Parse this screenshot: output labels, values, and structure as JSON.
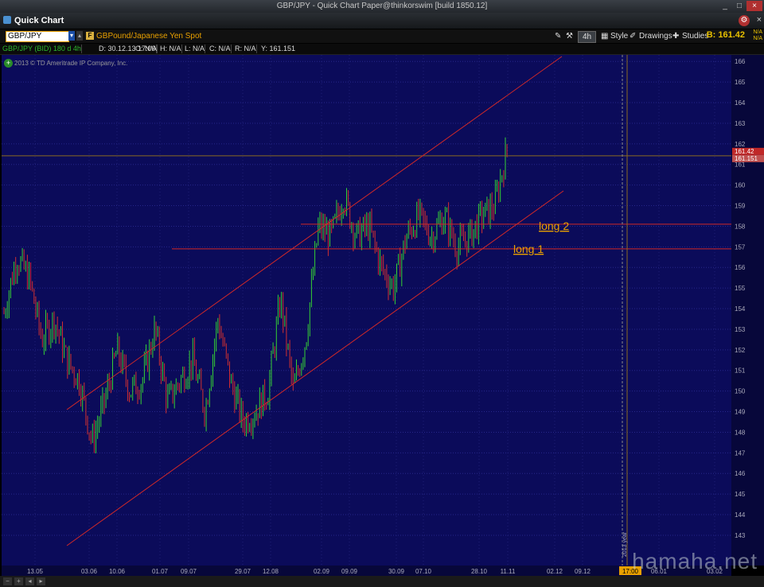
{
  "window": {
    "title": "GBP/JPY - Quick Chart Paper@thinkorswim [build 1850.12]",
    "minimize": "_",
    "maximize": "□",
    "close": "×"
  },
  "app": {
    "title": "Quick Chart",
    "close": "×"
  },
  "toolbar": {
    "symbol": "GBP/JPY",
    "symbol_name": "GBPound/Japanese Yen Spot",
    "timeframe": "4h",
    "style_label": "Style",
    "drawings_label": "Drawings",
    "studies_label": "Studies",
    "bid": "B: 161.42",
    "na1": "N/A",
    "na2": "N/A"
  },
  "infobar": {
    "symbol": "GBP/JPY (BID) 180 d 4h",
    "date": "D: 30.12.13 17:00",
    "open": "O: N/A",
    "high": "H: N/A",
    "low": "L: N/A",
    "close": "C: N/A",
    "range": "R: N/A",
    "y": "Y: 161.151"
  },
  "copyright": "2013 © TD Ameritrade IP Company, Inc.",
  "watermark": "hamaha.net",
  "colors": {
    "plot_bg": "#0b0b5a",
    "up": "#35d035",
    "down": "#d03030",
    "trendline": "#d02828",
    "accent": "#e8a000"
  },
  "chart_data": {
    "type": "candlestick",
    "symbol": "GBP/JPY",
    "ylim": [
      142.5,
      166.6
    ],
    "y_ticks": [
      143,
      144,
      145,
      146,
      147,
      148,
      149,
      150,
      151,
      152,
      153,
      154,
      155,
      156,
      157,
      158,
      159,
      160,
      161,
      162,
      163,
      164,
      165,
      166
    ],
    "x_ticks": [
      "13.05",
      "03.06",
      "10.06",
      "01.07",
      "09.07",
      "29.07",
      "12.08",
      "02.09",
      "09.09",
      "30.09",
      "07.10",
      "28.10",
      "11.11",
      "02.12",
      "09.12",
      "06.01",
      "03.02"
    ],
    "cursor_time_label": "17:00",
    "cursor_year_label": "2013 year",
    "current_price_label": "161.42",
    "cursor_price_label": "161.151",
    "annotations": [
      "long 2",
      "long 1"
    ],
    "price_path": [
      153.8,
      156.5,
      155.5,
      152.5,
      153.5,
      151.5,
      150.5,
      147.5,
      149.5,
      152.0,
      150.0,
      150.5,
      153.0,
      149.5,
      150.5,
      151.5,
      149.0,
      153.5,
      150.5,
      148.5,
      149.0,
      150.0,
      154.5,
      150.0,
      152.5,
      158.0,
      157.5,
      159.5,
      157.5,
      158.0,
      156.0,
      155.0,
      157.5,
      158.5,
      157.5,
      158.5,
      157.0,
      157.5,
      158.5,
      159.0,
      161.7
    ]
  }
}
